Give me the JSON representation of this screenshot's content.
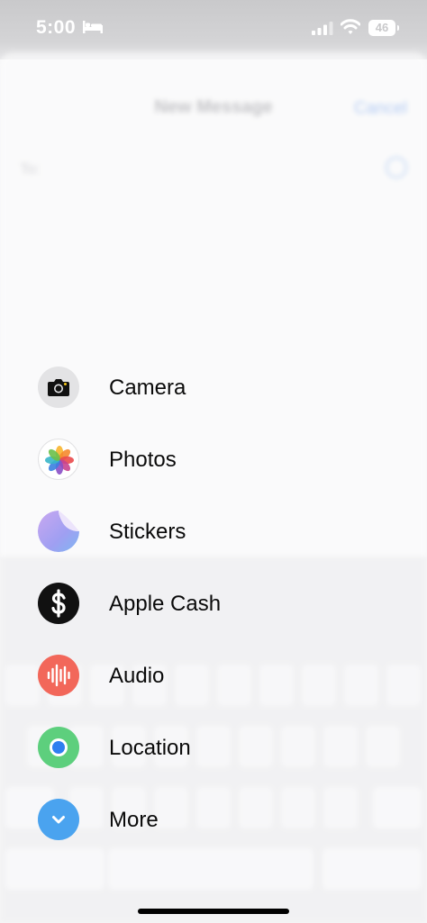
{
  "status_bar": {
    "time": "5:00",
    "battery": "46",
    "icons": [
      "bed-icon",
      "cellular-signal-icon",
      "wifi-icon",
      "battery-icon"
    ]
  },
  "background_sheet": {
    "title": "New Message",
    "cancel": "Cancel",
    "to_label": "To:"
  },
  "menu": {
    "items": [
      {
        "label": "Camera",
        "icon": "camera-icon"
      },
      {
        "label": "Photos",
        "icon": "photos-icon"
      },
      {
        "label": "Stickers",
        "icon": "stickers-icon"
      },
      {
        "label": "Apple Cash",
        "icon": "apple-cash-icon"
      },
      {
        "label": "Audio",
        "icon": "audio-waveform-icon"
      },
      {
        "label": "Location",
        "icon": "location-icon"
      },
      {
        "label": "More",
        "icon": "chevron-down-icon"
      }
    ]
  },
  "colors": {
    "camera": "#e3e3e5",
    "apple_cash": "#111111",
    "audio": "#f2675a",
    "location": "#5dcf7d",
    "more": "#4aa3ef"
  }
}
